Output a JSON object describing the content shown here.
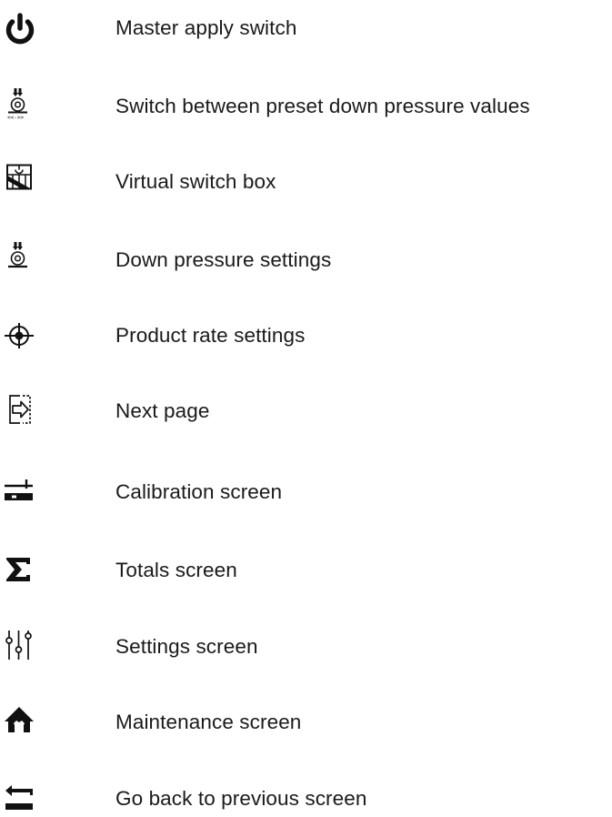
{
  "legend": {
    "items": [
      {
        "icon": "power-icon",
        "label": "Master apply switch"
      },
      {
        "icon": "preset-down-pressure-icon",
        "label": "Switch between preset down pressure values"
      },
      {
        "icon": "virtual-switch-box-icon",
        "label": "Virtual switch box"
      },
      {
        "icon": "down-pressure-icon",
        "label": "Down pressure settings"
      },
      {
        "icon": "crosshair-icon",
        "label": "Product rate settings"
      },
      {
        "icon": "next-page-icon",
        "label": "Next page"
      },
      {
        "icon": "calibration-icon",
        "label": "Calibration screen"
      },
      {
        "icon": "sigma-icon",
        "label": "Totals screen"
      },
      {
        "icon": "sliders-icon",
        "label": "Settings screen"
      },
      {
        "icon": "maintenance-icon",
        "label": "Maintenance screen"
      },
      {
        "icon": "back-arrow-icon",
        "label": "Go back to previous screen"
      }
    ]
  },
  "colors": {
    "ink": "#1a1a1a",
    "background": "#ffffff"
  }
}
